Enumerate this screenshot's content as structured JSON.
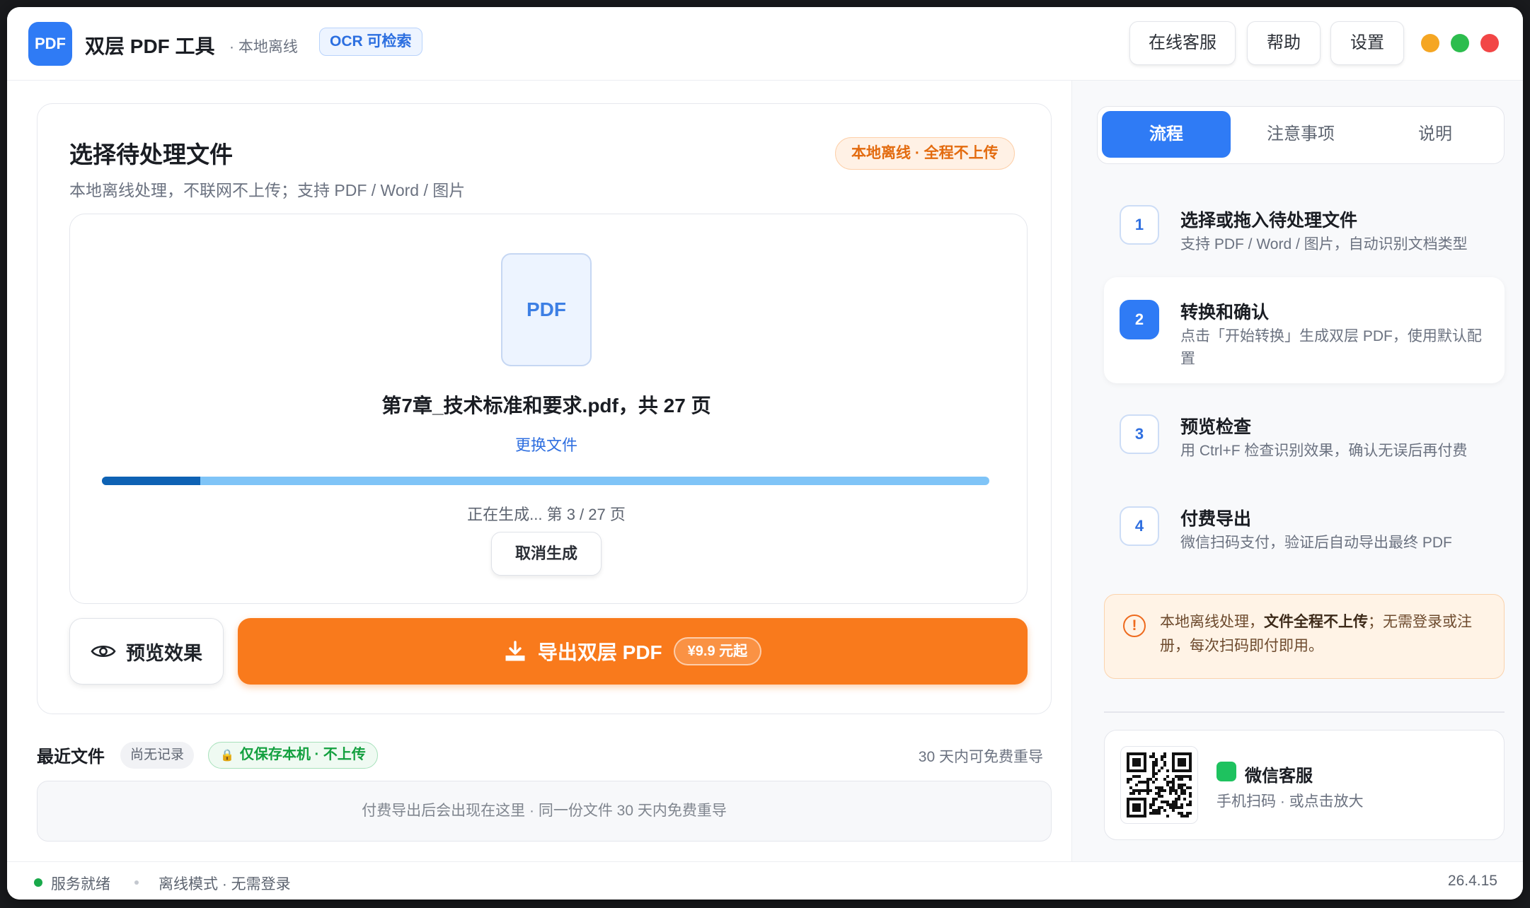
{
  "app": {
    "logo_text": "PDF",
    "title": "双层 PDF 工具",
    "subtitle": "· 本地离线",
    "ocr_badge": "OCR 可检索"
  },
  "titlebar": {
    "buttons": [
      "在线客服",
      "帮助",
      "设置"
    ],
    "window_dots": [
      "#f5a623",
      "#2dbd4e",
      "#f24646"
    ]
  },
  "selector": {
    "title": "选择待处理文件",
    "subtitle": "本地离线处理，不联网不上传；支持 PDF / Word / 图片",
    "offline_badge": "本地离线 · 全程不上传",
    "file_icon_label": "PDF",
    "file_name": "第7章_技术标准和要求.pdf，共 27 页",
    "change_file": "更换文件",
    "progress_current": 3,
    "progress_total": 27,
    "progress_text": "正在生成... 第 3 / 27 页",
    "cancel_button": "取消生成"
  },
  "actions": {
    "preview_button": "预览效果",
    "preview_icon": "eye-icon",
    "export_button": "导出双层 PDF",
    "export_icon": "download-icon",
    "export_price": "¥9.9 元起"
  },
  "recent": {
    "title": "最近文件",
    "no_record": "尚无记录",
    "local_badge": "仅保存本机 · 不上传",
    "redo_note": "30 天内可免费重导",
    "empty_text": "付费导出后会出现在这里 · 同一份文件 30 天内免费重导"
  },
  "sidebar": {
    "tabs": [
      "流程",
      "注意事项",
      "说明"
    ],
    "active_tab": 0,
    "steps": [
      {
        "num": "1",
        "title": "选择或拖入待处理文件",
        "desc": "支持 PDF / Word / 图片，自动识别文档类型"
      },
      {
        "num": "2",
        "title": "转换和确认",
        "desc": "点击「开始转换」生成双层 PDF，使用默认配置"
      },
      {
        "num": "3",
        "title": "预览检查",
        "desc": "用 Ctrl+F 检查识别效果，确认无误后再付费"
      },
      {
        "num": "4",
        "title": "付费导出",
        "desc": "微信扫码支付，验证后自动导出最终 PDF"
      }
    ],
    "notice_pre": "本地离线处理，",
    "notice_bold": "文件全程不上传",
    "notice_post": "；无需登录或注册，每次扫码即付即用。",
    "wechat_title": "微信客服",
    "wechat_sub": "手机扫码 · 或点击放大"
  },
  "status": {
    "ready": "服务就绪",
    "mode": "离线模式 · 无需登录",
    "version": "26.4.15"
  },
  "colors": {
    "accent": "#2f7bf5",
    "export": "#f97a1c",
    "progress_fill": "#0e62b4",
    "progress_track": "#7fc4f7"
  }
}
